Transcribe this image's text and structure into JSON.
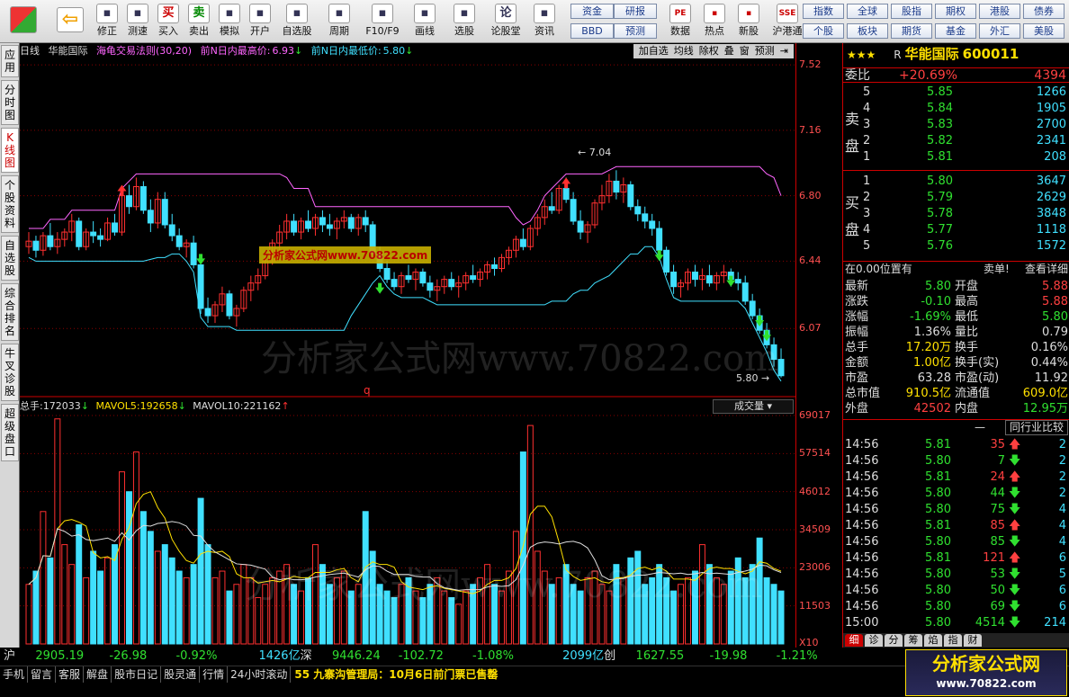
{
  "toolbar": {
    "left_buttons": [
      {
        "label": "修正",
        "icon": "up-down-arrows-icon"
      },
      {
        "label": "测速",
        "icon": "speedometer-icon"
      },
      {
        "label": "买入",
        "icon": "buy-icon",
        "glyph": "买"
      },
      {
        "label": "卖出",
        "icon": "sell-icon",
        "glyph": "卖"
      },
      {
        "label": "模拟",
        "icon": "hammer-icon"
      },
      {
        "label": "开户",
        "icon": "lock-icon"
      },
      {
        "label": "自选股",
        "icon": "star-icon"
      },
      {
        "label": "周期",
        "icon": "clock-icon"
      },
      {
        "label": "F10/F9",
        "icon": "document-icon"
      },
      {
        "label": "画线",
        "icon": "pencil-icon"
      },
      {
        "label": "选股",
        "icon": "screen-icon"
      },
      {
        "label": "论股堂",
        "icon": "chat-icon",
        "glyph": "论"
      },
      {
        "label": "资讯",
        "icon": "news-icon"
      }
    ],
    "mid_buttons": [
      "资金",
      "研报",
      "BBD",
      "预测"
    ],
    "icon_buttons": [
      {
        "label": "数据",
        "icon": "pe-icon",
        "glyph": "PE"
      },
      {
        "label": "热点",
        "icon": "fire-icon"
      },
      {
        "label": "新股",
        "icon": "new-stock-icon"
      },
      {
        "label": "沪港通",
        "icon": "shhk-icon",
        "glyph": "SSE"
      }
    ],
    "right_buttons": [
      "指数",
      "全球",
      "股指",
      "期权",
      "港股",
      "债券",
      "个股",
      "板块",
      "期货",
      "基金",
      "外汇",
      "美股"
    ]
  },
  "vtabs": [
    "应用",
    "分时图",
    "K线图",
    "个股资料",
    "自选股",
    "综合排名",
    "牛叉诊股",
    "超级盘口"
  ],
  "chart": {
    "period": "日线",
    "stock_name": "华能国际",
    "indicator": "海龟交易法则(30,20)",
    "high_label": "前N日内最高价:",
    "high_value": "6.93",
    "low_label": "前N日内最低价:",
    "low_value": "5.80",
    "tools": [
      "加自选",
      "均线",
      "除权",
      "叠",
      "窗",
      "预测"
    ],
    "marker_high": "7.04",
    "marker_low": "5.80",
    "marker_q": "q",
    "vol_label": "总手:",
    "vol_value": "172033",
    "mavol5_label": "MAVOL5:",
    "mavol5_value": "192658",
    "mavol10_label": "MAVOL10:",
    "mavol10_value": "221162",
    "vol_button": "成交量",
    "watermark": "分析家公式网www.70822.com",
    "watermark_box": "分析家公式网www.70822.com",
    "price_axis": [
      "7.52",
      "7.16",
      "6.80",
      "6.44",
      "6.07"
    ],
    "vol_axis": [
      "69017",
      "57514",
      "46012",
      "34509",
      "23006",
      "11503",
      "X10"
    ],
    "colors": {
      "up": "#ff3030",
      "down": "#40e0ff",
      "upper_band": "#ff66ff",
      "lower_band": "#40e0ff"
    }
  },
  "chart_data": {
    "type": "candlestick",
    "title": "华能国际 日线",
    "ylim": [
      5.7,
      7.55
    ],
    "vol_ylim": [
      0,
      69017
    ],
    "candles": [
      [
        6.52,
        6.6,
        6.48,
        6.55
      ],
      [
        6.55,
        6.58,
        6.46,
        6.5
      ],
      [
        6.5,
        6.6,
        6.47,
        6.58
      ],
      [
        6.58,
        6.65,
        6.5,
        6.52
      ],
      [
        6.52,
        6.6,
        6.48,
        6.56
      ],
      [
        6.56,
        6.62,
        6.52,
        6.6
      ],
      [
        6.6,
        6.7,
        6.55,
        6.66
      ],
      [
        6.66,
        6.68,
        6.5,
        6.52
      ],
      [
        6.52,
        6.62,
        6.5,
        6.6
      ],
      [
        6.6,
        6.66,
        6.54,
        6.58
      ],
      [
        6.58,
        6.62,
        6.52,
        6.56
      ],
      [
        6.56,
        6.68,
        6.55,
        6.65
      ],
      [
        6.65,
        6.7,
        6.58,
        6.6
      ],
      [
        6.6,
        6.82,
        6.58,
        6.8
      ],
      [
        6.8,
        6.86,
        6.7,
        6.74
      ],
      [
        6.74,
        6.9,
        6.72,
        6.85
      ],
      [
        6.85,
        6.88,
        6.7,
        6.72
      ],
      [
        6.72,
        6.78,
        6.6,
        6.65
      ],
      [
        6.65,
        6.82,
        6.62,
        6.78
      ],
      [
        6.78,
        6.82,
        6.62,
        6.64
      ],
      [
        6.64,
        6.7,
        6.55,
        6.58
      ],
      [
        6.58,
        6.62,
        6.5,
        6.52
      ],
      [
        6.52,
        6.56,
        6.46,
        6.54
      ],
      [
        6.54,
        6.58,
        6.4,
        6.42
      ],
      [
        6.42,
        6.45,
        6.15,
        6.18
      ],
      [
        6.18,
        6.24,
        6.1,
        6.14
      ],
      [
        6.14,
        6.22,
        6.1,
        6.2
      ],
      [
        6.2,
        6.3,
        6.16,
        6.26
      ],
      [
        6.26,
        6.28,
        6.12,
        6.14
      ],
      [
        6.14,
        6.2,
        6.08,
        6.18
      ],
      [
        6.18,
        6.3,
        6.16,
        6.28
      ],
      [
        6.28,
        6.36,
        6.22,
        6.32
      ],
      [
        6.32,
        6.4,
        6.28,
        6.36
      ],
      [
        6.36,
        6.46,
        6.34,
        6.44
      ],
      [
        6.44,
        6.56,
        6.42,
        6.54
      ],
      [
        6.54,
        6.64,
        6.5,
        6.6
      ],
      [
        6.6,
        6.7,
        6.56,
        6.66
      ],
      [
        6.66,
        6.7,
        6.58,
        6.6
      ],
      [
        6.6,
        6.68,
        6.56,
        6.66
      ],
      [
        6.66,
        6.72,
        6.6,
        6.62
      ],
      [
        6.62,
        6.7,
        6.58,
        6.68
      ],
      [
        6.68,
        6.72,
        6.6,
        6.64
      ],
      [
        6.64,
        6.7,
        6.58,
        6.62
      ],
      [
        6.62,
        6.68,
        6.56,
        6.66
      ],
      [
        6.66,
        6.72,
        6.62,
        6.68
      ],
      [
        6.68,
        6.7,
        6.6,
        6.62
      ],
      [
        6.62,
        6.7,
        6.58,
        6.68
      ],
      [
        6.68,
        6.72,
        6.6,
        6.64
      ],
      [
        6.64,
        6.66,
        6.46,
        6.48
      ],
      [
        6.48,
        6.52,
        6.38,
        6.4
      ],
      [
        6.4,
        6.44,
        6.32,
        6.34
      ],
      [
        6.34,
        6.38,
        6.28,
        6.3
      ],
      [
        6.3,
        6.38,
        6.26,
        6.36
      ],
      [
        6.36,
        6.42,
        6.32,
        6.34
      ],
      [
        6.34,
        6.4,
        6.28,
        6.38
      ],
      [
        6.38,
        6.4,
        6.3,
        6.32
      ],
      [
        6.32,
        6.36,
        6.24,
        6.28
      ],
      [
        6.28,
        6.34,
        6.22,
        6.3
      ],
      [
        6.3,
        6.36,
        6.26,
        6.34
      ],
      [
        6.34,
        6.38,
        6.28,
        6.3
      ],
      [
        6.3,
        6.36,
        6.24,
        6.32
      ],
      [
        6.32,
        6.38,
        6.28,
        6.36
      ],
      [
        6.36,
        6.42,
        6.32,
        6.34
      ],
      [
        6.34,
        6.4,
        6.3,
        6.38
      ],
      [
        6.38,
        6.44,
        6.34,
        6.42
      ],
      [
        6.42,
        6.46,
        6.36,
        6.4
      ],
      [
        6.4,
        6.48,
        6.38,
        6.46
      ],
      [
        6.46,
        6.52,
        6.42,
        6.5
      ],
      [
        6.5,
        6.58,
        6.46,
        6.56
      ],
      [
        6.56,
        6.62,
        6.5,
        6.52
      ],
      [
        6.52,
        6.64,
        6.5,
        6.62
      ],
      [
        6.62,
        6.7,
        6.58,
        6.68
      ],
      [
        6.68,
        6.78,
        6.64,
        6.74
      ],
      [
        6.74,
        6.82,
        6.7,
        6.72
      ],
      [
        6.72,
        6.86,
        6.7,
        6.84
      ],
      [
        6.84,
        6.9,
        6.76,
        6.78
      ],
      [
        6.78,
        6.82,
        6.64,
        6.66
      ],
      [
        6.66,
        6.72,
        6.56,
        6.6
      ],
      [
        6.6,
        6.66,
        6.54,
        6.64
      ],
      [
        6.64,
        6.78,
        6.62,
        6.76
      ],
      [
        6.76,
        6.86,
        6.72,
        6.8
      ],
      [
        6.8,
        6.92,
        6.76,
        6.88
      ],
      [
        6.88,
        6.94,
        6.78,
        6.82
      ],
      [
        6.82,
        6.9,
        6.76,
        6.86
      ],
      [
        6.86,
        6.88,
        6.72,
        6.74
      ],
      [
        6.74,
        6.78,
        6.66,
        6.7
      ],
      [
        6.7,
        6.74,
        6.62,
        6.66
      ],
      [
        6.66,
        6.7,
        6.58,
        6.62
      ],
      [
        6.62,
        6.66,
        6.48,
        6.5
      ],
      [
        6.5,
        6.52,
        6.36,
        6.38
      ],
      [
        6.38,
        6.42,
        6.26,
        6.3
      ],
      [
        6.3,
        6.34,
        6.24,
        6.32
      ],
      [
        6.32,
        6.4,
        6.28,
        6.38
      ],
      [
        6.38,
        6.42,
        6.3,
        6.34
      ],
      [
        6.34,
        6.4,
        6.28,
        6.36
      ],
      [
        6.36,
        6.42,
        6.3,
        6.32
      ],
      [
        6.32,
        6.38,
        6.28,
        6.36
      ],
      [
        6.36,
        6.42,
        6.32,
        6.38
      ],
      [
        6.38,
        6.4,
        6.3,
        6.34
      ],
      [
        6.34,
        6.38,
        6.28,
        6.32
      ],
      [
        6.32,
        6.36,
        6.2,
        6.22
      ],
      [
        6.22,
        6.26,
        6.12,
        6.14
      ],
      [
        6.14,
        6.18,
        6.04,
        6.06
      ],
      [
        6.06,
        6.1,
        5.96,
        5.98
      ],
      [
        5.98,
        6.02,
        5.86,
        5.9
      ],
      [
        5.9,
        5.96,
        5.8,
        5.81
      ]
    ],
    "volume": [
      18000,
      22000,
      40000,
      26000,
      68000,
      30000,
      24000,
      36000,
      20000,
      28000,
      22000,
      26000,
      30000,
      52000,
      46000,
      58000,
      40000,
      34000,
      28000,
      30000,
      26000,
      22000,
      20000,
      24000,
      44000,
      30000,
      20000,
      22000,
      16000,
      18000,
      24000,
      20000,
      14000,
      18000,
      20000,
      22000,
      24000,
      18000,
      16000,
      20000,
      30000,
      24000,
      18000,
      20000,
      22000,
      16000,
      18000,
      40000,
      28000,
      18000,
      16000,
      14000,
      18000,
      20000,
      16000,
      14000,
      18000,
      20000,
      16000,
      14000,
      12000,
      16000,
      18000,
      20000,
      24000,
      18000,
      16000,
      22000,
      34000,
      58000,
      66000,
      28000,
      22000,
      18000,
      20000,
      24000,
      18000,
      16000,
      20000,
      22000,
      18000,
      16000,
      24000,
      20000,
      26000,
      28000,
      18000,
      20000,
      24000,
      20000,
      16000,
      18000,
      20000,
      22000,
      30000,
      24000,
      20000,
      18000,
      22000,
      26000,
      20000,
      24000,
      32000,
      20000,
      18000,
      16000
    ]
  },
  "quote": {
    "stars": "★★★",
    "r_mark": "R",
    "name": "华能国际",
    "code": "600011",
    "weibi_label": "委比",
    "weibi_pct": "+20.69%",
    "weibi_num": "4394",
    "sell_label": "卖盘",
    "buy_label": "买盘",
    "sells": [
      [
        "5",
        "5.85",
        "1266"
      ],
      [
        "4",
        "5.84",
        "1905"
      ],
      [
        "3",
        "5.83",
        "2700"
      ],
      [
        "2",
        "5.82",
        "2341"
      ],
      [
        "1",
        "5.81",
        "208"
      ]
    ],
    "buys": [
      [
        "1",
        "5.80",
        "3647"
      ],
      [
        "2",
        "5.79",
        "2629"
      ],
      [
        "3",
        "5.78",
        "3848"
      ],
      [
        "4",
        "5.77",
        "1118"
      ],
      [
        "5",
        "5.76",
        "1572"
      ]
    ],
    "pos_text": "在0.00位置有",
    "sell_order": "卖单!",
    "detail_link": "查看详细",
    "stats": [
      [
        "最新",
        "5.80",
        "g",
        "开盘",
        "5.88",
        "r"
      ],
      [
        "涨跌",
        "-0.10",
        "g",
        "最高",
        "5.88",
        "r"
      ],
      [
        "涨幅",
        "-1.69%",
        "g",
        "最低",
        "5.80",
        "g"
      ],
      [
        "振幅",
        "1.36%",
        "w",
        "量比",
        "0.79",
        "w"
      ],
      [
        "总手",
        "17.20万",
        "y",
        "换手",
        "0.16%",
        "w"
      ],
      [
        "金额",
        "1.00亿",
        "y",
        "换手(实)",
        "0.44%",
        "w"
      ],
      [
        "市盈",
        "63.28",
        "w",
        "市盈(动)",
        "11.92",
        "w"
      ],
      [
        "总市值",
        "910.5亿",
        "y",
        "流通值",
        "609.0亿",
        "y"
      ],
      [
        "外盘",
        "42502",
        "r",
        "内盘",
        "12.95万",
        "g"
      ]
    ],
    "compare_btn": "同行业比较",
    "dash": "—",
    "ticks": [
      [
        "14:56",
        "5.81",
        "35",
        "up",
        "2"
      ],
      [
        "14:56",
        "5.80",
        "7",
        "down",
        "2"
      ],
      [
        "14:56",
        "5.81",
        "24",
        "up",
        "2"
      ],
      [
        "14:56",
        "5.80",
        "44",
        "down",
        "2"
      ],
      [
        "14:56",
        "5.80",
        "75",
        "down",
        "4"
      ],
      [
        "14:56",
        "5.81",
        "85",
        "up",
        "4"
      ],
      [
        "14:56",
        "5.80",
        "85",
        "down",
        "4"
      ],
      [
        "14:56",
        "5.81",
        "121",
        "up",
        "6"
      ],
      [
        "14:56",
        "5.80",
        "53",
        "down",
        "5"
      ],
      [
        "14:56",
        "5.80",
        "50",
        "down",
        "6"
      ],
      [
        "14:56",
        "5.80",
        "69",
        "down",
        "6"
      ],
      [
        "15:00",
        "5.80",
        "4514",
        "down",
        "214"
      ]
    ],
    "tabs": [
      "细",
      "诊",
      "分",
      "筹",
      "焰",
      "指",
      "财"
    ]
  },
  "status": {
    "sh_label": "沪",
    "sh_index": "2905.19",
    "sh_chg": "-26.98",
    "sh_pct": "-0.92%",
    "sh_amt": "1426亿",
    "sz_label": "深",
    "sz_index": "9446.24",
    "sz_chg": "-102.72",
    "sz_pct": "-1.08%",
    "sz_amt": "2099亿",
    "cy_label": "创",
    "cy_index": "1627.55",
    "cy_chg": "-19.98",
    "cy_pct": "-1.21%",
    "bar": [
      "手机",
      "留言",
      "客服",
      "解盘",
      "股市日记",
      "股灵通",
      "行情",
      "24小时滚动"
    ],
    "news": "55 九寨沟管理局：10月6日前门票已售罄"
  },
  "logo": {
    "title": "分析家公式网",
    "url": "www.70822.com"
  }
}
